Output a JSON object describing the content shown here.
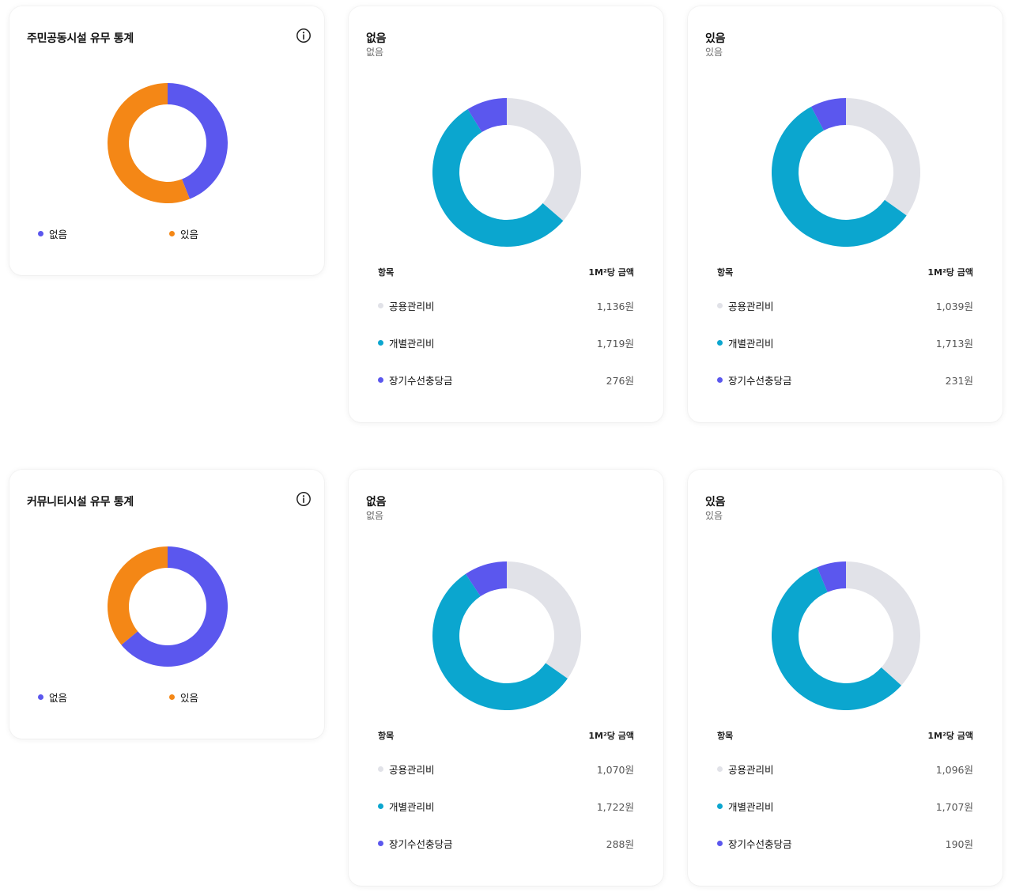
{
  "colors": {
    "none": "#5b57ee",
    "exists": "#f48716",
    "common_fee": "#e1e2e8",
    "individual_fee": "#0ba6cf",
    "long_term_fund": "#5b57ee"
  },
  "sections": [
    {
      "summary": {
        "title": "주민공동시설 유무 통계",
        "info_icon": "info-icon",
        "legend": [
          {
            "label": "없음",
            "color": "#5b57ee"
          },
          {
            "label": "있음",
            "color": "#f48716"
          }
        ]
      },
      "details": [
        {
          "title": "없음",
          "subtitle": "없음",
          "table_headers": {
            "item": "항목",
            "amount": "1M²당 금액"
          },
          "rows": [
            {
              "label": "공용관리비",
              "amount": "1,136원",
              "color": "#e1e2e8"
            },
            {
              "label": "개별관리비",
              "amount": "1,719원",
              "color": "#0ba6cf"
            },
            {
              "label": "장기수선충당금",
              "amount": "276원",
              "color": "#5b57ee"
            }
          ]
        },
        {
          "title": "있음",
          "subtitle": "있음",
          "table_headers": {
            "item": "항목",
            "amount": "1M²당 금액"
          },
          "rows": [
            {
              "label": "공용관리비",
              "amount": "1,039원",
              "color": "#e1e2e8"
            },
            {
              "label": "개별관리비",
              "amount": "1,713원",
              "color": "#0ba6cf"
            },
            {
              "label": "장기수선충당금",
              "amount": "231원",
              "color": "#5b57ee"
            }
          ]
        }
      ]
    },
    {
      "summary": {
        "title": "커뮤니티시설 유무 통계",
        "info_icon": "info-icon",
        "legend": [
          {
            "label": "없음",
            "color": "#5b57ee"
          },
          {
            "label": "있음",
            "color": "#f48716"
          }
        ]
      },
      "details": [
        {
          "title": "없음",
          "subtitle": "없음",
          "table_headers": {
            "item": "항목",
            "amount": "1M²당 금액"
          },
          "rows": [
            {
              "label": "공용관리비",
              "amount": "1,070원",
              "color": "#e1e2e8"
            },
            {
              "label": "개별관리비",
              "amount": "1,722원",
              "color": "#0ba6cf"
            },
            {
              "label": "장기수선충당금",
              "amount": "288원",
              "color": "#5b57ee"
            }
          ]
        },
        {
          "title": "있음",
          "subtitle": "있음",
          "table_headers": {
            "item": "항목",
            "amount": "1M²당 금액"
          },
          "rows": [
            {
              "label": "공용관리비",
              "amount": "1,096원",
              "color": "#e1e2e8"
            },
            {
              "label": "개별관리비",
              "amount": "1,707원",
              "color": "#0ba6cf"
            },
            {
              "label": "장기수선충당금",
              "amount": "190원",
              "color": "#5b57ee"
            }
          ]
        }
      ]
    }
  ],
  "chart_data": [
    {
      "type": "pie",
      "title": "주민공동시설 유무 통계",
      "categories": [
        "없음",
        "있음"
      ],
      "values": [
        44,
        56
      ],
      "colors": [
        "#5b57ee",
        "#f48716"
      ]
    },
    {
      "type": "pie",
      "title": "없음",
      "categories": [
        "공용관리비",
        "개별관리비",
        "장기수선충당금"
      ],
      "values": [
        1136,
        1719,
        276
      ],
      "colors": [
        "#e1e2e8",
        "#0ba6cf",
        "#5b57ee"
      ]
    },
    {
      "type": "pie",
      "title": "있음",
      "categories": [
        "공용관리비",
        "개별관리비",
        "장기수선충당금"
      ],
      "values": [
        1039,
        1713,
        231
      ],
      "colors": [
        "#e1e2e8",
        "#0ba6cf",
        "#5b57ee"
      ]
    },
    {
      "type": "pie",
      "title": "커뮤니티시설 유무 통계",
      "categories": [
        "없음",
        "있음"
      ],
      "values": [
        64,
        36
      ],
      "colors": [
        "#5b57ee",
        "#f48716"
      ]
    },
    {
      "type": "pie",
      "title": "없음",
      "categories": [
        "공용관리비",
        "개별관리비",
        "장기수선충당금"
      ],
      "values": [
        1070,
        1722,
        288
      ],
      "colors": [
        "#e1e2e8",
        "#0ba6cf",
        "#5b57ee"
      ]
    },
    {
      "type": "pie",
      "title": "있음",
      "categories": [
        "공용관리비",
        "개별관리비",
        "장기수선충당금"
      ],
      "values": [
        1096,
        1707,
        190
      ],
      "colors": [
        "#e1e2e8",
        "#0ba6cf",
        "#5b57ee"
      ]
    }
  ]
}
